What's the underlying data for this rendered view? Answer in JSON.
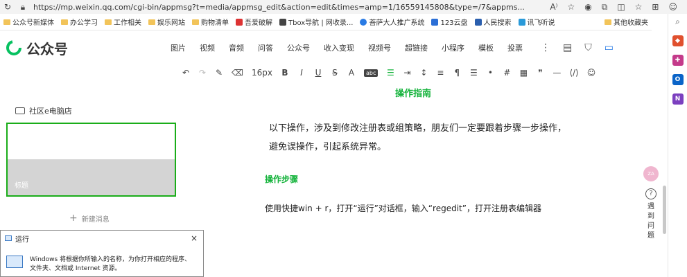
{
  "browser": {
    "url": "https://mp.weixin.qq.com/cgi-bin/appmsg?t=media/appmsg_edit&action=edit&times=amp=1/16559145808&type=/7&appms..."
  },
  "bookmarks": [
    {
      "label": "公众号新媒体",
      "type": "folder"
    },
    {
      "label": "办公学习",
      "type": "folder"
    },
    {
      "label": "工作相关",
      "type": "folder"
    },
    {
      "label": "娱乐网站",
      "type": "folder"
    },
    {
      "label": "购物清单",
      "type": "folder"
    },
    {
      "label": "吾爱破解",
      "type": "site"
    },
    {
      "label": "Tbox导航 | 网收录...",
      "type": "site"
    },
    {
      "label": "菩萨大人推广系统",
      "type": "site"
    },
    {
      "label": "123云盘",
      "type": "site"
    },
    {
      "label": "人民搜索",
      "type": "site"
    },
    {
      "label": "讯飞听说",
      "type": "site"
    },
    {
      "label": "其他收藏夹",
      "type": "folder"
    }
  ],
  "header": {
    "logo": "公众号",
    "menu": [
      "图片",
      "视频",
      "音频",
      "问答",
      "公众号",
      "收入变现",
      "视频号",
      "超链接",
      "小程序",
      "模板",
      "投票"
    ]
  },
  "toolbar": {
    "font_size": "16px",
    "selection_badge": "abc"
  },
  "left": {
    "channel": "社区e电脑店",
    "card_title": "标题",
    "new_message": "新建消息"
  },
  "article": {
    "guide_title": "操作指南",
    "intro_line1": "以下操作，涉及到修改注册表或组策略，朋友们一定要跟着步骤一步操作，",
    "intro_line2": "避免误操作，引起系统异常。",
    "steps_title": "操作步骤",
    "step1": "使用快捷win + r，打开“运行”对话框，输入“regedit”，打开注册表编辑器"
  },
  "float": {
    "bubble": "ZA",
    "help": "遇到问题"
  },
  "run_dialog": {
    "title": "运行",
    "close": "×",
    "desc": "Windows 将根据你所输入的名称，为你打开相应的程序、文件夹、文档或 Internet 资源。"
  }
}
